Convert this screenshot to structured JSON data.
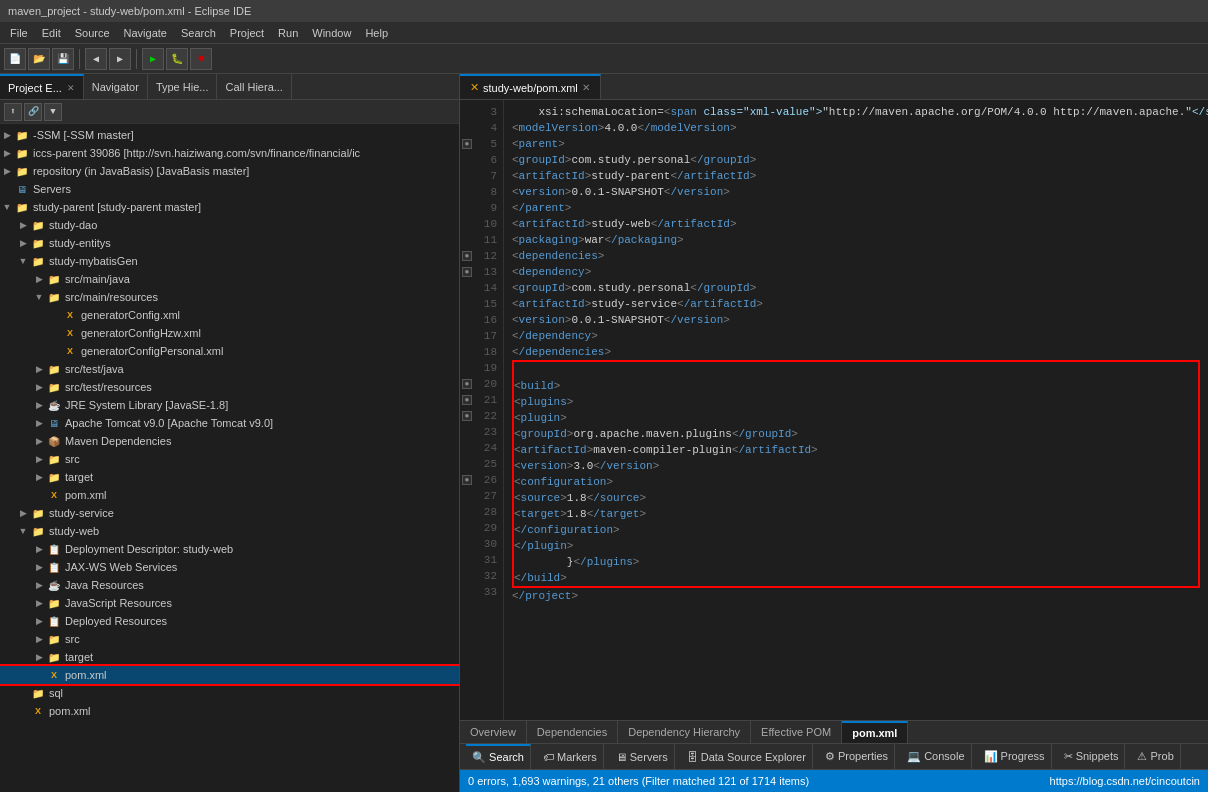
{
  "titleBar": {
    "text": "maven_project - study-web/pom.xml - Eclipse IDE"
  },
  "menuBar": {
    "items": [
      "File",
      "Edit",
      "Source",
      "Navigate",
      "Search",
      "Project",
      "Run",
      "Window",
      "Help"
    ]
  },
  "leftPanel": {
    "tabs": [
      {
        "label": "Project E...",
        "active": true,
        "closeable": true
      },
      {
        "label": "Navigator",
        "active": false,
        "closeable": false
      },
      {
        "label": "Type Hie...",
        "active": false,
        "closeable": false
      },
      {
        "label": "Call Hiera...",
        "active": false,
        "closeable": false
      }
    ],
    "tree": [
      {
        "depth": 0,
        "arrow": "▶",
        "icon": "📁",
        "iconClass": "icon-project",
        "label": "-SSM [-SSM master]",
        "selected": false
      },
      {
        "depth": 0,
        "arrow": "▶",
        "icon": "📁",
        "iconClass": "icon-project",
        "label": "iccs-parent 39086 [http://svn.haiziwang.com/svn/finance/financial/ic",
        "selected": false
      },
      {
        "depth": 0,
        "arrow": "▶",
        "icon": "📁",
        "iconClass": "icon-project",
        "label": "repository (in JavaBasis) [JavaBasis master]",
        "selected": false
      },
      {
        "depth": 0,
        "arrow": "",
        "icon": "🖥",
        "iconClass": "icon-server",
        "label": "Servers",
        "selected": false
      },
      {
        "depth": 0,
        "arrow": "▼",
        "icon": "📁",
        "iconClass": "icon-project",
        "label": "study-parent [study-parent master]",
        "selected": false
      },
      {
        "depth": 1,
        "arrow": "▶",
        "icon": "📁",
        "iconClass": "icon-folder",
        "label": "study-dao",
        "selected": false
      },
      {
        "depth": 1,
        "arrow": "▶",
        "icon": "📁",
        "iconClass": "icon-folder",
        "label": "study-entitys",
        "selected": false
      },
      {
        "depth": 1,
        "arrow": "▼",
        "icon": "📁",
        "iconClass": "icon-folder",
        "label": "study-mybatisGen",
        "selected": false
      },
      {
        "depth": 2,
        "arrow": "▶",
        "icon": "📁",
        "iconClass": "icon-folder-src",
        "label": "src/main/java",
        "selected": false
      },
      {
        "depth": 2,
        "arrow": "▼",
        "icon": "📁",
        "iconClass": "icon-folder-src",
        "label": "src/main/resources",
        "selected": false
      },
      {
        "depth": 3,
        "arrow": "",
        "icon": "✕",
        "iconClass": "icon-file-xml",
        "label": "generatorConfig.xml",
        "selected": false
      },
      {
        "depth": 3,
        "arrow": "",
        "icon": "✕",
        "iconClass": "icon-file-xml",
        "label": "generatorConfigHzw.xml",
        "selected": false
      },
      {
        "depth": 3,
        "arrow": "",
        "icon": "✕",
        "iconClass": "icon-file-xml",
        "label": "generatorConfigPersonal.xml",
        "selected": false
      },
      {
        "depth": 2,
        "arrow": "▶",
        "icon": "📁",
        "iconClass": "icon-folder-src",
        "label": "src/test/java",
        "selected": false
      },
      {
        "depth": 2,
        "arrow": "▶",
        "icon": "📁",
        "iconClass": "icon-folder-src",
        "label": "src/test/resources",
        "selected": false
      },
      {
        "depth": 2,
        "arrow": "▶",
        "icon": "☕",
        "iconClass": "icon-jar",
        "label": "JRE System Library [JavaSE-1.8]",
        "selected": false
      },
      {
        "depth": 2,
        "arrow": "▶",
        "icon": "🐈",
        "iconClass": "icon-server",
        "label": "Apache Tomcat v9.0 [Apache Tomcat v9.0]",
        "selected": false
      },
      {
        "depth": 2,
        "arrow": "▶",
        "icon": "📦",
        "iconClass": "icon-maven",
        "label": "Maven Dependencies",
        "selected": false
      },
      {
        "depth": 2,
        "arrow": "▶",
        "icon": "📁",
        "iconClass": "icon-folder",
        "label": "src",
        "selected": false
      },
      {
        "depth": 2,
        "arrow": "▶",
        "icon": "📁",
        "iconClass": "icon-folder",
        "label": "target",
        "selected": false
      },
      {
        "depth": 2,
        "arrow": "",
        "icon": "✕",
        "iconClass": "icon-file-xml",
        "label": "pom.xml",
        "selected": false
      },
      {
        "depth": 1,
        "arrow": "▶",
        "icon": "📁",
        "iconClass": "icon-folder",
        "label": "study-service",
        "selected": false
      },
      {
        "depth": 1,
        "arrow": "▼",
        "icon": "📁",
        "iconClass": "icon-folder",
        "label": "study-web",
        "selected": false
      },
      {
        "depth": 2,
        "arrow": "▶",
        "icon": "📋",
        "iconClass": "icon-deploy",
        "label": "Deployment Descriptor: study-web",
        "selected": false
      },
      {
        "depth": 2,
        "arrow": "▶",
        "icon": "🔗",
        "iconClass": "icon-deploy",
        "label": "JAX-WS Web Services",
        "selected": false
      },
      {
        "depth": 2,
        "arrow": "▶",
        "icon": "☕",
        "iconClass": "icon-jar",
        "label": "Java Resources",
        "selected": false
      },
      {
        "depth": 2,
        "arrow": "▶",
        "icon": "📜",
        "iconClass": "icon-folder",
        "label": "JavaScript Resources",
        "selected": false
      },
      {
        "depth": 2,
        "arrow": "▶",
        "icon": "📁",
        "iconClass": "icon-deploy",
        "label": "Deployed Resources",
        "selected": false
      },
      {
        "depth": 2,
        "arrow": "▶",
        "icon": "📁",
        "iconClass": "icon-folder",
        "label": "src",
        "selected": false
      },
      {
        "depth": 2,
        "arrow": "▶",
        "icon": "📁",
        "iconClass": "icon-folder",
        "label": "target",
        "selected": false
      },
      {
        "depth": 2,
        "arrow": "",
        "icon": "✕",
        "iconClass": "icon-file-xml",
        "label": "pom.xml",
        "selected": true,
        "redBorder": true
      },
      {
        "depth": 1,
        "arrow": "",
        "icon": "🗃",
        "iconClass": "icon-folder",
        "label": "sql",
        "selected": false
      },
      {
        "depth": 1,
        "arrow": "",
        "icon": "✕",
        "iconClass": "icon-file-xml",
        "label": "pom.xml",
        "selected": false
      }
    ]
  },
  "editorTab": {
    "label": "study-web/pom.xml",
    "closeable": true
  },
  "codeLines": [
    {
      "num": 3,
      "hasCollapse": false,
      "content": "    xsi:schemaLocation=<v>\"http://maven.apache.org/POM/4.0.0 http://maven.apache.\"</v>"
    },
    {
      "num": 4,
      "hasCollapse": false,
      "content": "    <modelVersion>4.0.0</modelVersion>"
    },
    {
      "num": 5,
      "hasCollapse": true,
      "collapseChar": "●",
      "content": "    <parent>"
    },
    {
      "num": 6,
      "hasCollapse": false,
      "content": "        <groupId>com.study.personal</groupId>"
    },
    {
      "num": 7,
      "hasCollapse": false,
      "content": "        <artifactId>study-parent</artifactId>"
    },
    {
      "num": 8,
      "hasCollapse": false,
      "content": "        <version>0.0.1-SNAPSHOT</version>"
    },
    {
      "num": 9,
      "hasCollapse": false,
      "content": "    </parent>"
    },
    {
      "num": 10,
      "hasCollapse": false,
      "content": "    <artifactId>study-web</artifactId>"
    },
    {
      "num": 11,
      "hasCollapse": false,
      "content": "    <packaging>war</packaging>"
    },
    {
      "num": 12,
      "hasCollapse": true,
      "collapseChar": "●",
      "content": "    <dependencies>"
    },
    {
      "num": 13,
      "hasCollapse": true,
      "collapseChar": "●",
      "content": "        <dependency>"
    },
    {
      "num": 14,
      "hasCollapse": false,
      "content": "            <groupId>com.study.personal</groupId>"
    },
    {
      "num": 15,
      "hasCollapse": false,
      "content": "            <artifactId>study-service</artifactId>"
    },
    {
      "num": 16,
      "hasCollapse": false,
      "content": "            <version>0.0.1-SNAPSHOT</version>"
    },
    {
      "num": 17,
      "hasCollapse": false,
      "content": "        </dependency>"
    },
    {
      "num": 18,
      "hasCollapse": false,
      "content": "    </dependencies>"
    },
    {
      "num": 19,
      "hasCollapse": false,
      "content": "",
      "inRedBox": true
    },
    {
      "num": 20,
      "hasCollapse": true,
      "collapseChar": "●",
      "content": "    <build>",
      "inRedBox": true
    },
    {
      "num": 21,
      "hasCollapse": true,
      "collapseChar": "●",
      "content": "        <plugins>",
      "inRedBox": true
    },
    {
      "num": 22,
      "hasCollapse": true,
      "collapseChar": "●",
      "content": "            <plugin>",
      "inRedBox": true
    },
    {
      "num": 23,
      "hasCollapse": false,
      "content": "                <groupId>org.apache.maven.plugins</groupId>",
      "inRedBox": true
    },
    {
      "num": 24,
      "hasCollapse": false,
      "content": "                <artifactId>maven-compiler-plugin</artifactId>",
      "inRedBox": true
    },
    {
      "num": 25,
      "hasCollapse": false,
      "content": "                <version>3.0</version>",
      "inRedBox": true
    },
    {
      "num": 26,
      "hasCollapse": true,
      "collapseChar": "●",
      "content": "                <configuration>",
      "inRedBox": true
    },
    {
      "num": 27,
      "hasCollapse": false,
      "content": "                    <source>1.8</source>",
      "inRedBox": true
    },
    {
      "num": 28,
      "hasCollapse": false,
      "content": "                    <target>1.8</target>",
      "inRedBox": true
    },
    {
      "num": 29,
      "hasCollapse": false,
      "content": "                </configuration>",
      "inRedBox": true
    },
    {
      "num": 30,
      "hasCollapse": false,
      "content": "            </plugin>",
      "inRedBox": true
    },
    {
      "num": 31,
      "hasCollapse": false,
      "content": "        }</plugins>",
      "inRedBox": true
    },
    {
      "num": 32,
      "hasCollapse": false,
      "content": "    </build>",
      "inRedBox": true
    },
    {
      "num": 33,
      "hasCollapse": false,
      "content": "</project>"
    }
  ],
  "bottomTabs": [
    {
      "label": "Overview",
      "active": false
    },
    {
      "label": "Dependencies",
      "active": false
    },
    {
      "label": "Dependency Hierarchy",
      "active": false
    },
    {
      "label": "Effective POM",
      "active": false
    },
    {
      "label": "pom.xml",
      "active": true
    }
  ],
  "bottomPanel": {
    "tabs": [
      {
        "label": "🔍 Search",
        "active": true
      },
      {
        "label": "🏷 Markers",
        "active": false
      },
      {
        "label": "🖥 Servers",
        "active": false
      },
      {
        "label": "🗄 Data Source Explorer",
        "active": false
      },
      {
        "label": "⚙ Properties",
        "active": false
      },
      {
        "label": "💻 Console",
        "active": false
      },
      {
        "label": "📊 Progress",
        "active": false
      },
      {
        "label": "✂ Snippets",
        "active": false
      },
      {
        "label": "⚠ Prob",
        "active": false
      }
    ],
    "searchLabel": "Search",
    "statusText": "0 errors, 1,693 warnings, 21 others (Filter matched 121 of 1714 items)",
    "rightStatus": "https://blog.csdn.net/cincoutcin"
  }
}
